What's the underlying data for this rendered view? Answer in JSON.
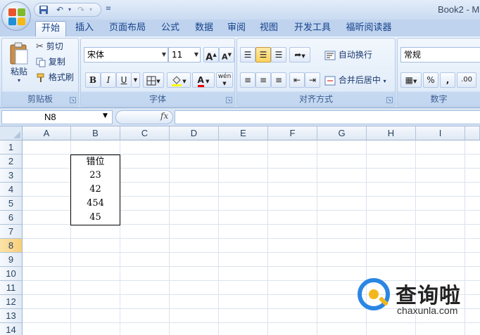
{
  "window": {
    "title": "Book2 - M"
  },
  "tabs": [
    {
      "label": "开始",
      "active": true
    },
    {
      "label": "插入"
    },
    {
      "label": "页面布局"
    },
    {
      "label": "公式"
    },
    {
      "label": "数据"
    },
    {
      "label": "审阅"
    },
    {
      "label": "视图"
    },
    {
      "label": "开发工具"
    },
    {
      "label": "福昕阅读器"
    }
  ],
  "ribbon": {
    "clipboard": {
      "label": "剪贴板",
      "paste": "粘贴",
      "cut": "剪切",
      "copy": "复制",
      "format_painter": "格式刷"
    },
    "font": {
      "label": "字体",
      "font_name": "宋体",
      "font_size": "11",
      "bold": "B",
      "italic": "I",
      "underline": "U",
      "font_color_letter": "A",
      "phonetic": "wén"
    },
    "alignment": {
      "label": "对齐方式",
      "wrap_text": "自动换行",
      "merge_center": "合并后居中"
    },
    "number": {
      "label": "数字",
      "format": "常规",
      "percent": "%",
      "comma": ",",
      "decimal": ".00"
    }
  },
  "formula_bar": {
    "name_box": "N8",
    "fx": "fx",
    "value": ""
  },
  "sheet": {
    "columns": [
      "A",
      "B",
      "C",
      "D",
      "E",
      "F",
      "G",
      "H",
      "I"
    ],
    "rows": [
      "1",
      "2",
      "3",
      "4",
      "5",
      "6",
      "7",
      "8",
      "9",
      "10",
      "11",
      "12",
      "13",
      "14"
    ],
    "selected_row": "8",
    "b_column": [
      "错位",
      "23",
      "42",
      "454",
      "45"
    ]
  },
  "watermark": {
    "name": "查询啦",
    "url": "chaxunla.com"
  },
  "colors": {
    "accent": "#15428b",
    "tab_bg": "#bfd3ee",
    "selection": "#f8cf78",
    "watermark_blue": "#2b86e3",
    "watermark_yellow": "#f2b71b"
  }
}
